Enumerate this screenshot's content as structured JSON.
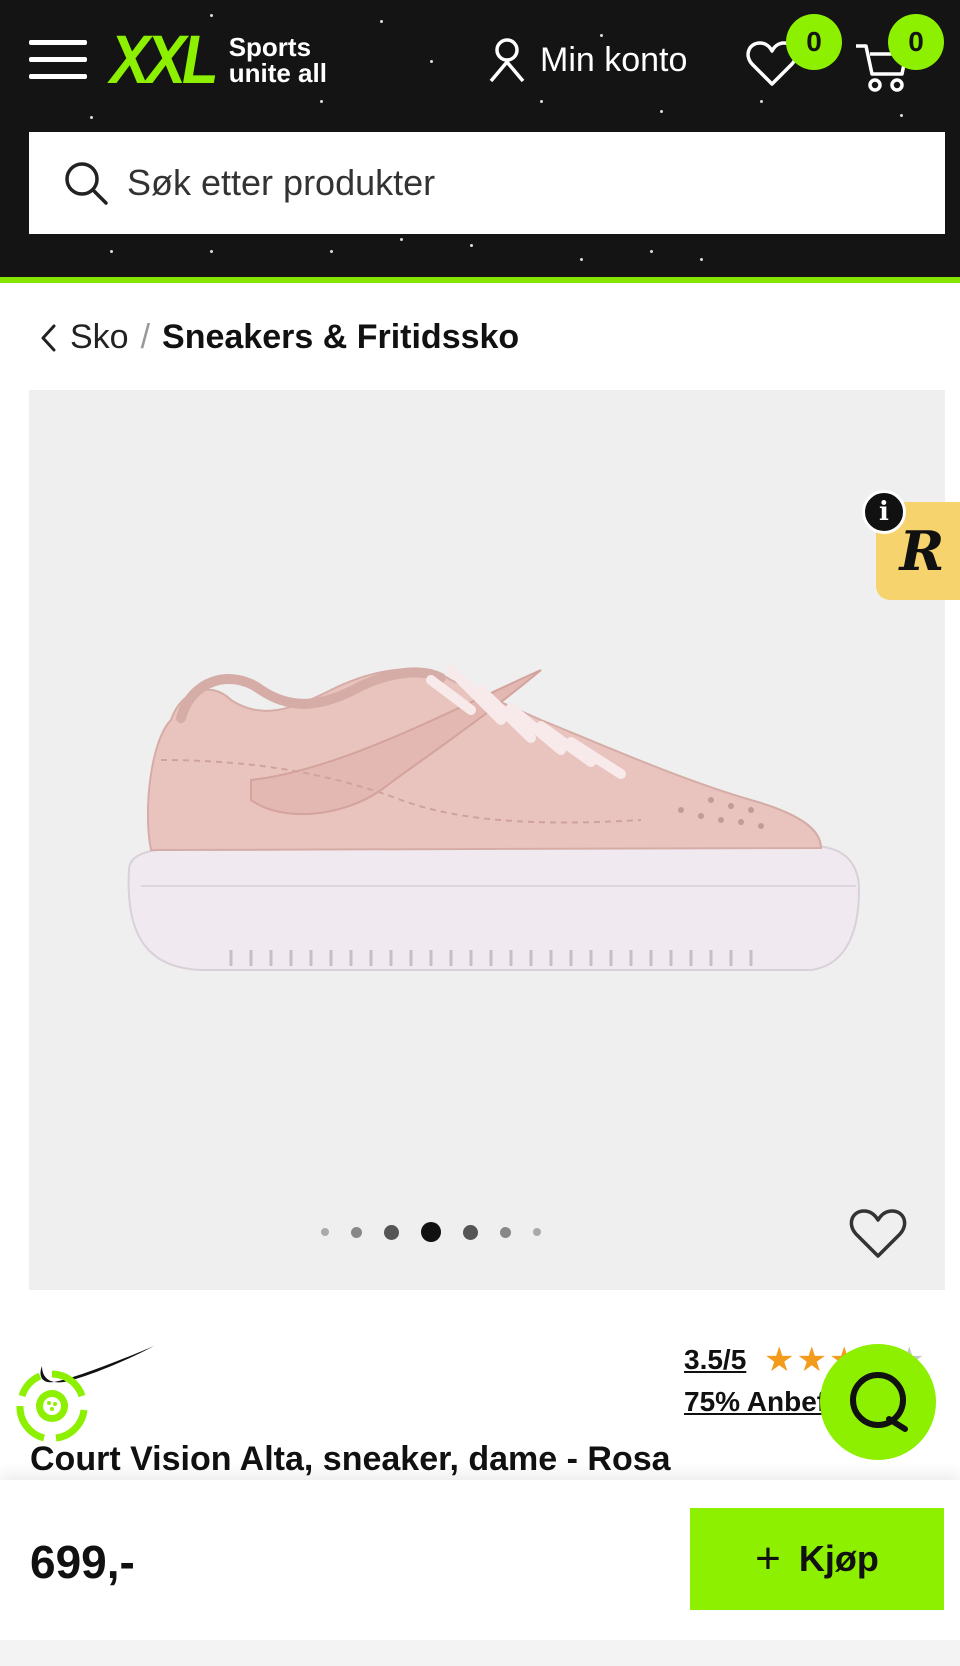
{
  "header": {
    "logo_text": "XXL",
    "tagline_line1": "Sports",
    "tagline_line2": "unite all",
    "account_label": "Min konto",
    "wishlist_count": "0",
    "cart_count": "0",
    "search_placeholder": "Søk etter produkter",
    "colors": {
      "background": "#141414",
      "accent": "#8cf000"
    }
  },
  "breadcrumb": {
    "items": [
      "Sko",
      "Sneakers & Fritidssko"
    ],
    "separator": "/"
  },
  "gallery": {
    "image": "pink-sneaker-product-photo",
    "dot_count": 7,
    "active_dot_index": 3
  },
  "review_widget": {
    "letter": "R",
    "info_label": "i"
  },
  "product": {
    "brand_logo": "nike-swoosh-logo",
    "title": "Court Vision Alta, sneaker, dame - Rosa",
    "rating": "3.5/5",
    "rating_value": 3.5,
    "rating_max": 5,
    "recommend": "75% Anbefaler"
  },
  "buy": {
    "price": "699,-",
    "button_label": "Kjøp",
    "button_icon": "plus-icon"
  }
}
